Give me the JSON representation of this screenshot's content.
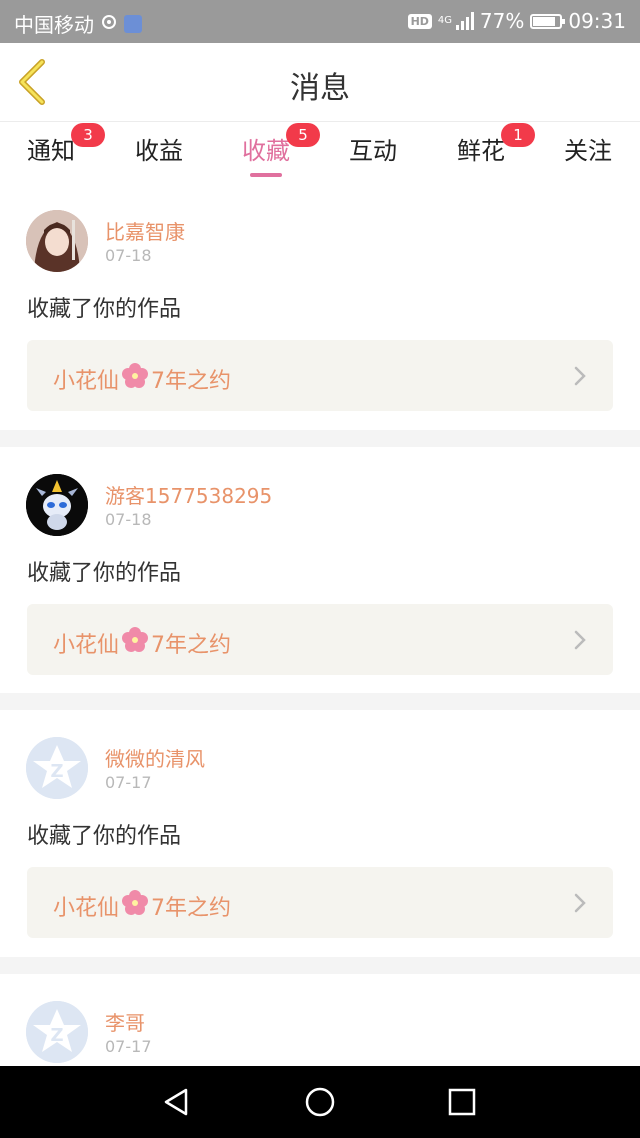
{
  "status_bar": {
    "carrier": "中国移动",
    "hd": "HD",
    "network": "4G",
    "battery": "77%",
    "battery_level": 0.77,
    "time": "09:31"
  },
  "header": {
    "title": "消息",
    "back_icon": "chevron-left-icon"
  },
  "tabs": [
    {
      "label": "通知",
      "badge": "3",
      "active": false
    },
    {
      "label": "收益",
      "badge": "",
      "active": false
    },
    {
      "label": "收藏",
      "badge": "5",
      "active": true
    },
    {
      "label": "互动",
      "badge": "",
      "active": false
    },
    {
      "label": "鲜花",
      "badge": "1",
      "active": false
    },
    {
      "label": "关注",
      "badge": "",
      "active": false
    }
  ],
  "messages": [
    {
      "username": "比嘉智康",
      "date": "07-18",
      "action": "收藏了你的作品",
      "work_title_part1": "小花仙",
      "work_title_part2": "7年之约",
      "avatar": "anime-girl-avatar"
    },
    {
      "username": "游客1577538295",
      "date": "07-18",
      "action": "收藏了你的作品",
      "work_title_part1": "小花仙",
      "work_title_part2": "7年之约",
      "avatar": "robot-cat-avatar"
    },
    {
      "username": "微微的清风",
      "date": "07-17",
      "action": "收藏了你的作品",
      "work_title_part1": "小花仙",
      "work_title_part2": "7年之约",
      "avatar": "default-z-avatar"
    },
    {
      "username": "李哥",
      "date": "07-17",
      "action": "",
      "work_title_part1": "",
      "work_title_part2": "",
      "avatar": "default-z-avatar"
    }
  ],
  "colors": {
    "accent": "#e0709e",
    "username": "#e8936a",
    "badge": "#f23a4a",
    "work_box_bg": "#f5f4ef"
  }
}
